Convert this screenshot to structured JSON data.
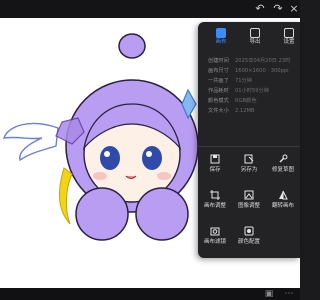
{
  "topbar": {
    "undo_icon": "undo-icon",
    "redo_icon": "redo-icon",
    "close_icon": "close-icon"
  },
  "panel": {
    "tabs": [
      {
        "label": "画布",
        "icon": "canvas-icon",
        "active": true
      },
      {
        "label": "导出",
        "icon": "export-icon",
        "active": false
      },
      {
        "label": "设置",
        "icon": "settings-icon",
        "active": false
      }
    ],
    "info": [
      {
        "key": "创建时间",
        "value": "2025年04月20日 23时"
      },
      {
        "key": "画布尺寸",
        "value": "1600×1600 · 300ppi"
      },
      {
        "key": "一共画了",
        "value": "71分钟"
      },
      {
        "key": "作品耗时",
        "value": "01小时59分钟"
      },
      {
        "key": "颜色模式",
        "value": "RGB颜色"
      },
      {
        "key": "文件大小",
        "value": "2.12MB"
      }
    ],
    "actions": [
      {
        "label": "保存",
        "icon": "save-icon"
      },
      {
        "label": "另存为",
        "icon": "save-as-icon"
      },
      {
        "label": "修复草图",
        "icon": "wrench-icon"
      },
      {
        "label": "画布调整",
        "icon": "crop-icon"
      },
      {
        "label": "图像调整",
        "icon": "image-adjust-icon"
      },
      {
        "label": "翻转画布",
        "icon": "flip-icon"
      },
      {
        "label": "画布滤镜",
        "icon": "camera-icon"
      },
      {
        "label": "颜色配置",
        "icon": "color-config-icon"
      }
    ]
  }
}
